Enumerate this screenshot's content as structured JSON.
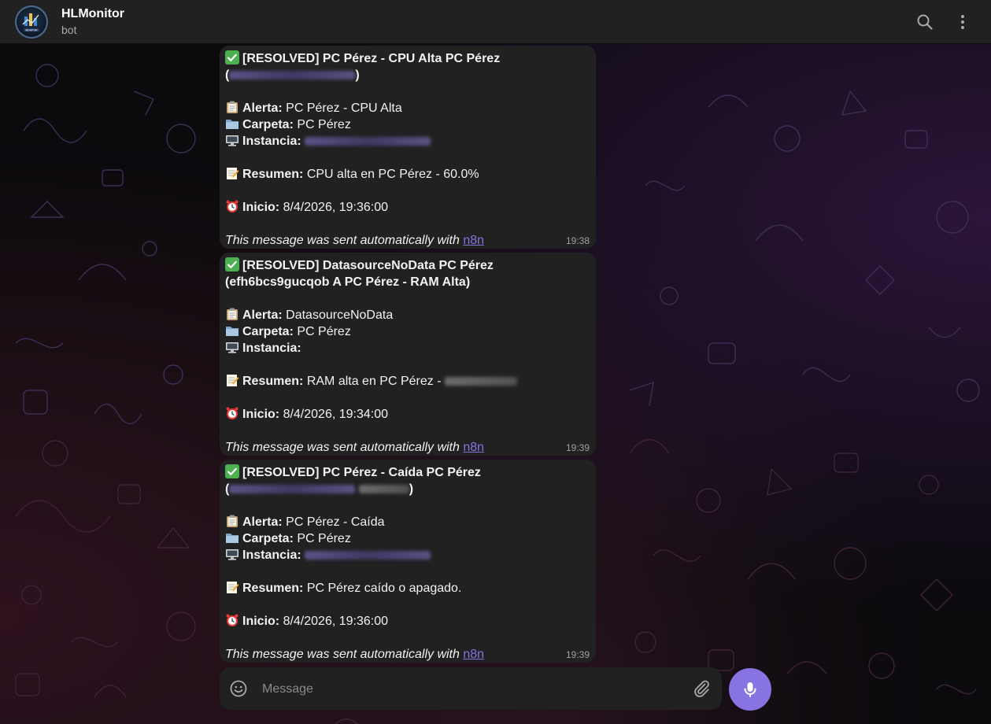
{
  "header": {
    "title": "HLMonitor",
    "subtitle": "bot",
    "avatar_text": "MONITOR",
    "search_icon": "search-icon",
    "menu_icon": "more-vertical-icon"
  },
  "labels": {
    "alerta": "Alerta:",
    "carpeta": "Carpeta:",
    "instancia": "Instancia:",
    "resumen": "Resumen:",
    "inicio": "Inicio:",
    "footer_text": "This message was sent automatically with",
    "footer_link": "n8n"
  },
  "messages": [
    {
      "title": "[RESOLVED] PC Pérez - CPU Alta PC Pérez",
      "alerta": "PC Pérez - CPU Alta",
      "carpeta": "PC Pérez",
      "resumen": "CPU alta en PC Pérez - 60.0%",
      "inicio": "8/4/2026, 19:36:00",
      "time": "19:38"
    },
    {
      "title": "[RESOLVED] DatasourceNoData PC Pérez (efh6bcs9gucqob A PC Pérez - RAM Alta)",
      "alerta": "DatasourceNoData",
      "carpeta": "PC Pérez",
      "resumen": "RAM alta en PC Pérez -",
      "inicio": "8/4/2026, 19:34:00",
      "time": "19:39"
    },
    {
      "title": "[RESOLVED] PC Pérez - Caída PC Pérez",
      "alerta": "PC Pérez - Caída",
      "carpeta": "PC Pérez",
      "resumen": "PC Pérez caído o apagado.",
      "inicio": "8/4/2026, 19:36:00",
      "time": "19:39"
    }
  ],
  "composer": {
    "placeholder": "Message",
    "emoji_icon": "smiley-icon",
    "attach_icon": "paperclip-icon",
    "mic_icon": "microphone-icon"
  },
  "colors": {
    "accent": "#8774e1",
    "bubble": "#212121",
    "header": "#212121",
    "background": "#0b0a0d"
  }
}
